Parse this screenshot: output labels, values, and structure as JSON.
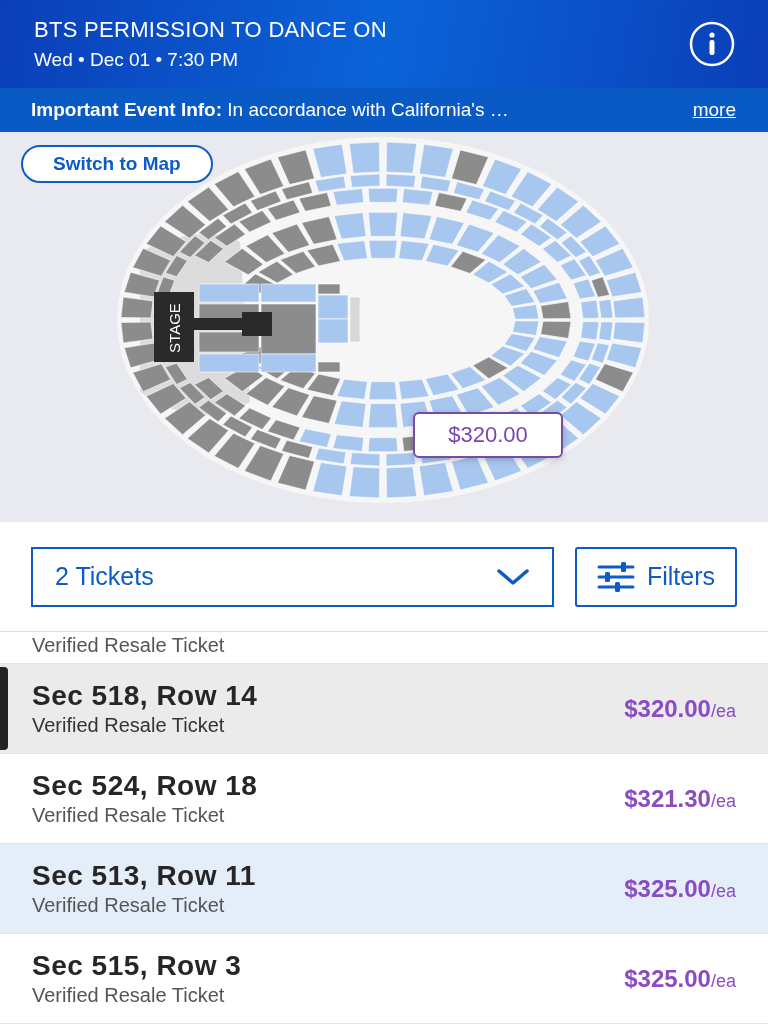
{
  "header": {
    "title": "BTS PERMISSION TO DANCE ON",
    "date": "Wed • Dec 01 • 7:30 PM"
  },
  "notice": {
    "text": "**Important Event Info:** In accordance with California's …",
    "link": "more"
  },
  "map": {
    "switch_button": "Switch to Map",
    "stage_label": "STAGE",
    "price_callout": "$320.00"
  },
  "controls": {
    "quantity": "2 Tickets",
    "filters": "Filters"
  },
  "listings": [
    {
      "type": "Verified Resale Ticket",
      "selected": false,
      "highlighted": false,
      "partial": true
    },
    {
      "section": "Sec 518, Row 14",
      "type": "Verified Resale Ticket",
      "price": "$320.00",
      "unit": "/ea",
      "selected": true,
      "highlighted": false,
      "partial": false
    },
    {
      "section": "Sec 524, Row 18",
      "type": "Verified Resale Ticket",
      "price": "$321.30",
      "unit": "/ea",
      "selected": false,
      "highlighted": false,
      "partial": false
    },
    {
      "section": "Sec 513, Row 11",
      "type": "Verified Resale Ticket",
      "price": "$325.00",
      "unit": "/ea",
      "selected": false,
      "highlighted": true,
      "partial": false
    },
    {
      "section": "Sec 515, Row 3",
      "type": "Verified Resale Ticket",
      "price": "$325.00",
      "unit": "/ea",
      "selected": false,
      "highlighted": false,
      "partial": false
    }
  ]
}
